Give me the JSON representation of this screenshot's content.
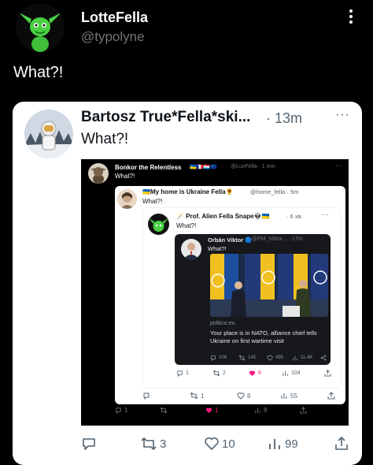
{
  "post": {
    "author_name": "LotteFella",
    "author_handle": "@typolyne",
    "text": "What?!"
  },
  "quoted": {
    "author_name": "Bartosz True*Fella*ski...",
    "time": "· 13m",
    "text": "What?!",
    "actions": {
      "retweets": "3",
      "likes": "10",
      "views": "99"
    }
  },
  "screenshot": {
    "author_name": "Bonkor the Relentless",
    "flags": "🇺🇦🇫🇷🇱🇺🇪🇺",
    "handle": "@LuxFella · 1 min",
    "text": "What?!",
    "actions": {
      "replies": "1",
      "likes": "1",
      "views": "8"
    },
    "level2": {
      "author_name": "🇺🇦My home is Ukraine Fella🌻",
      "handle": "@home_fella · 5m",
      "text": "What?!",
      "actions": {
        "retweets": "1",
        "likes": "6",
        "views": "55"
      }
    },
    "level3": {
      "author_name": "🪄 Prof. Alien Fella Snape👽🇺🇦",
      "handle": "· 6 хв.",
      "text": "What?!",
      "actions": {
        "replies": "1",
        "retweets": "2",
        "likes": "8",
        "views": "104"
      }
    },
    "level4": {
      "author_name": "Orbán Viktor 🔵",
      "handle": "@PM_Viktor... · 17m",
      "text": "What?!",
      "source": "politico.eu",
      "headline": "Your place is in NATO, alliance chief tells Ukraine on first wartime visit",
      "actions": {
        "replies": "104",
        "retweets": "145",
        "likes": "495",
        "views": "11.4K"
      }
    }
  },
  "colors": {
    "like_pink": "#f91880",
    "muted": "#536471",
    "dark_bg": "#000000"
  }
}
